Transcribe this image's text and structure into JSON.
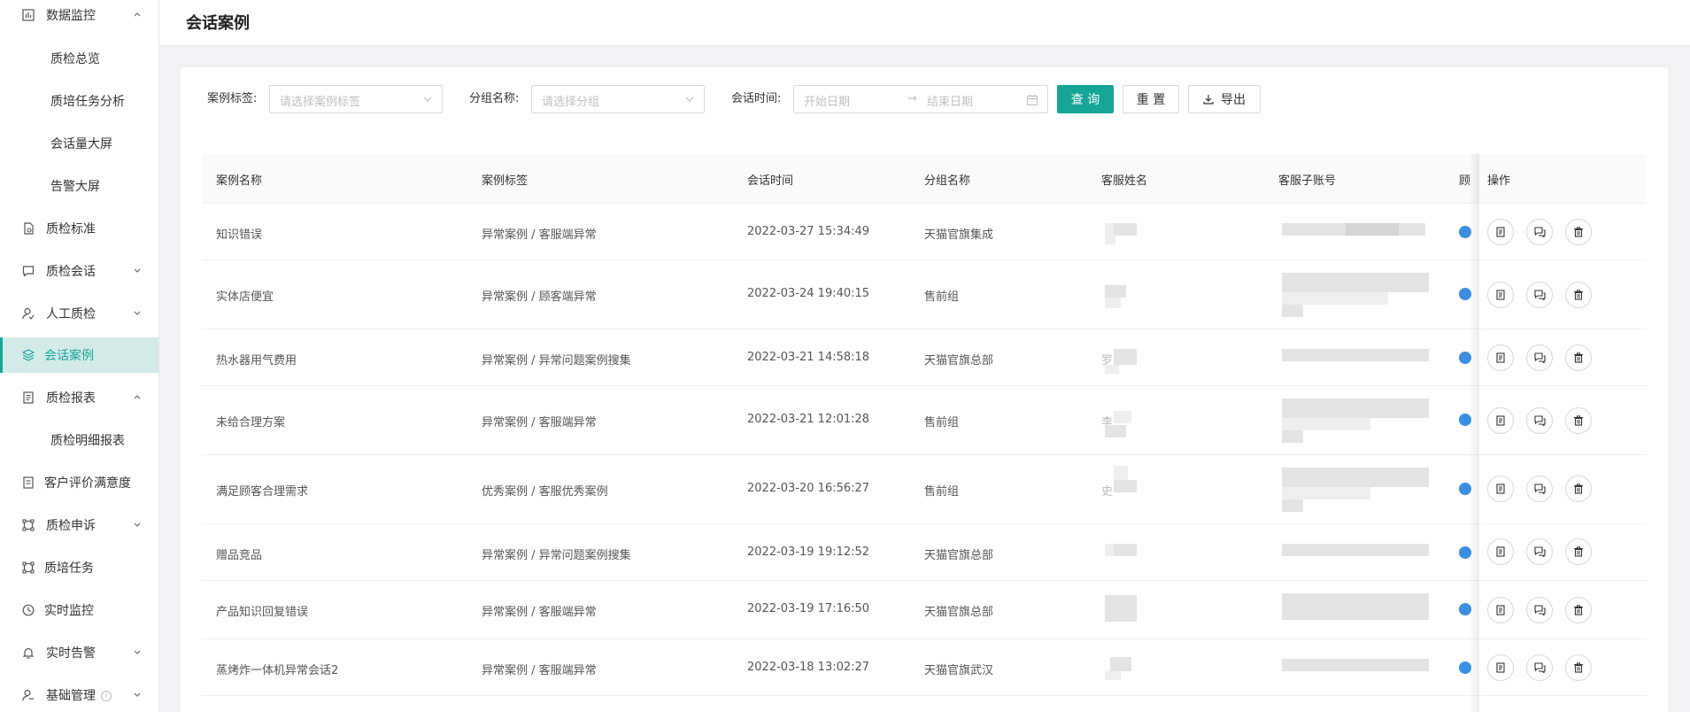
{
  "sidebar": {
    "items": [
      {
        "label": "数据监控",
        "icon": "bar-chart-icon",
        "chevron": "up"
      },
      {
        "label": "质检总览",
        "sub": true
      },
      {
        "label": "质培任务分析",
        "sub": true
      },
      {
        "label": "会话量大屏",
        "sub": true
      },
      {
        "label": "告警大屏",
        "sub": true
      },
      {
        "label": "质检标准",
        "icon": "document-icon"
      },
      {
        "label": "质检会话",
        "icon": "chat-icon",
        "chevron": "down"
      },
      {
        "label": "人工质检",
        "icon": "user-check-icon",
        "chevron": "down"
      },
      {
        "label": "会话案例",
        "icon": "layers-icon",
        "active": true
      },
      {
        "label": "质检报表",
        "icon": "report-icon",
        "chevron": "up"
      },
      {
        "label": "质检明细报表",
        "sub": true
      },
      {
        "label": "客户评价满意度",
        "icon": "rating-icon"
      },
      {
        "label": "质检申诉",
        "icon": "appeal-icon",
        "chevron": "down"
      },
      {
        "label": "质培任务",
        "icon": "task-icon"
      },
      {
        "label": "实时监控",
        "icon": "clock-icon"
      },
      {
        "label": "实时告警",
        "icon": "bell-icon",
        "chevron": "down"
      },
      {
        "label": "基础管理",
        "icon": "user-settings-icon",
        "chevron": "down",
        "info": "i"
      }
    ]
  },
  "header": {
    "title": "会话案例"
  },
  "filters": {
    "case_tag_label": "案例标签:",
    "case_tag_placeholder": "请选择案例标签",
    "group_label": "分组名称:",
    "group_placeholder": "请选择分组",
    "time_label": "会话时间:",
    "start_placeholder": "开始日期",
    "range_sep": "→",
    "end_placeholder": "结束日期",
    "query": "查 询",
    "reset": "重 置",
    "export": "导出"
  },
  "table": {
    "columns": [
      "案例名称",
      "案例标签",
      "会话时间",
      "分组名称",
      "客服姓名",
      "客服子账号",
      "顾",
      "操作"
    ],
    "rows": [
      {
        "name": "知识错误",
        "tag": "异常案例 / 客服端异常",
        "time": "2022-03-27 15:34:49",
        "group": "天猫官旗集成"
      },
      {
        "name": "实体店便宜",
        "tag": "异常案例 / 顾客端异常",
        "time": "2022-03-24 19:40:15",
        "group": "售前组"
      },
      {
        "name": "热水器用气费用",
        "tag": "异常案例 / 异常问题案例搜集",
        "time": "2022-03-21 14:58:18",
        "group": "天猫官旗总部",
        "agent": "罗"
      },
      {
        "name": "未给合理方案",
        "tag": "异常案例 / 客服端异常",
        "time": "2022-03-21 12:01:28",
        "group": "售前组",
        "agent": "李"
      },
      {
        "name": "满足顾客合理需求",
        "tag": "优秀案例 / 客服优秀案例",
        "time": "2022-03-20 16:56:27",
        "group": "售前组",
        "agent": "史"
      },
      {
        "name": "赠品竞品",
        "tag": "异常案例 / 异常问题案例搜集",
        "time": "2022-03-19 19:12:52",
        "group": "天猫官旗总部"
      },
      {
        "name": "产品知识回复错误",
        "tag": "异常案例 / 客服端异常",
        "time": "2022-03-19 17:16:50",
        "group": "天猫官旗总部"
      },
      {
        "name": "蒸烤炸一体机异常会话2",
        "tag": "异常案例 / 客服端异常",
        "time": "2022-03-18 13:02:27",
        "group": "天猫官旗武汉"
      }
    ]
  },
  "colors": {
    "accent": "#16a597",
    "active_bg": "#d3ebe8"
  }
}
